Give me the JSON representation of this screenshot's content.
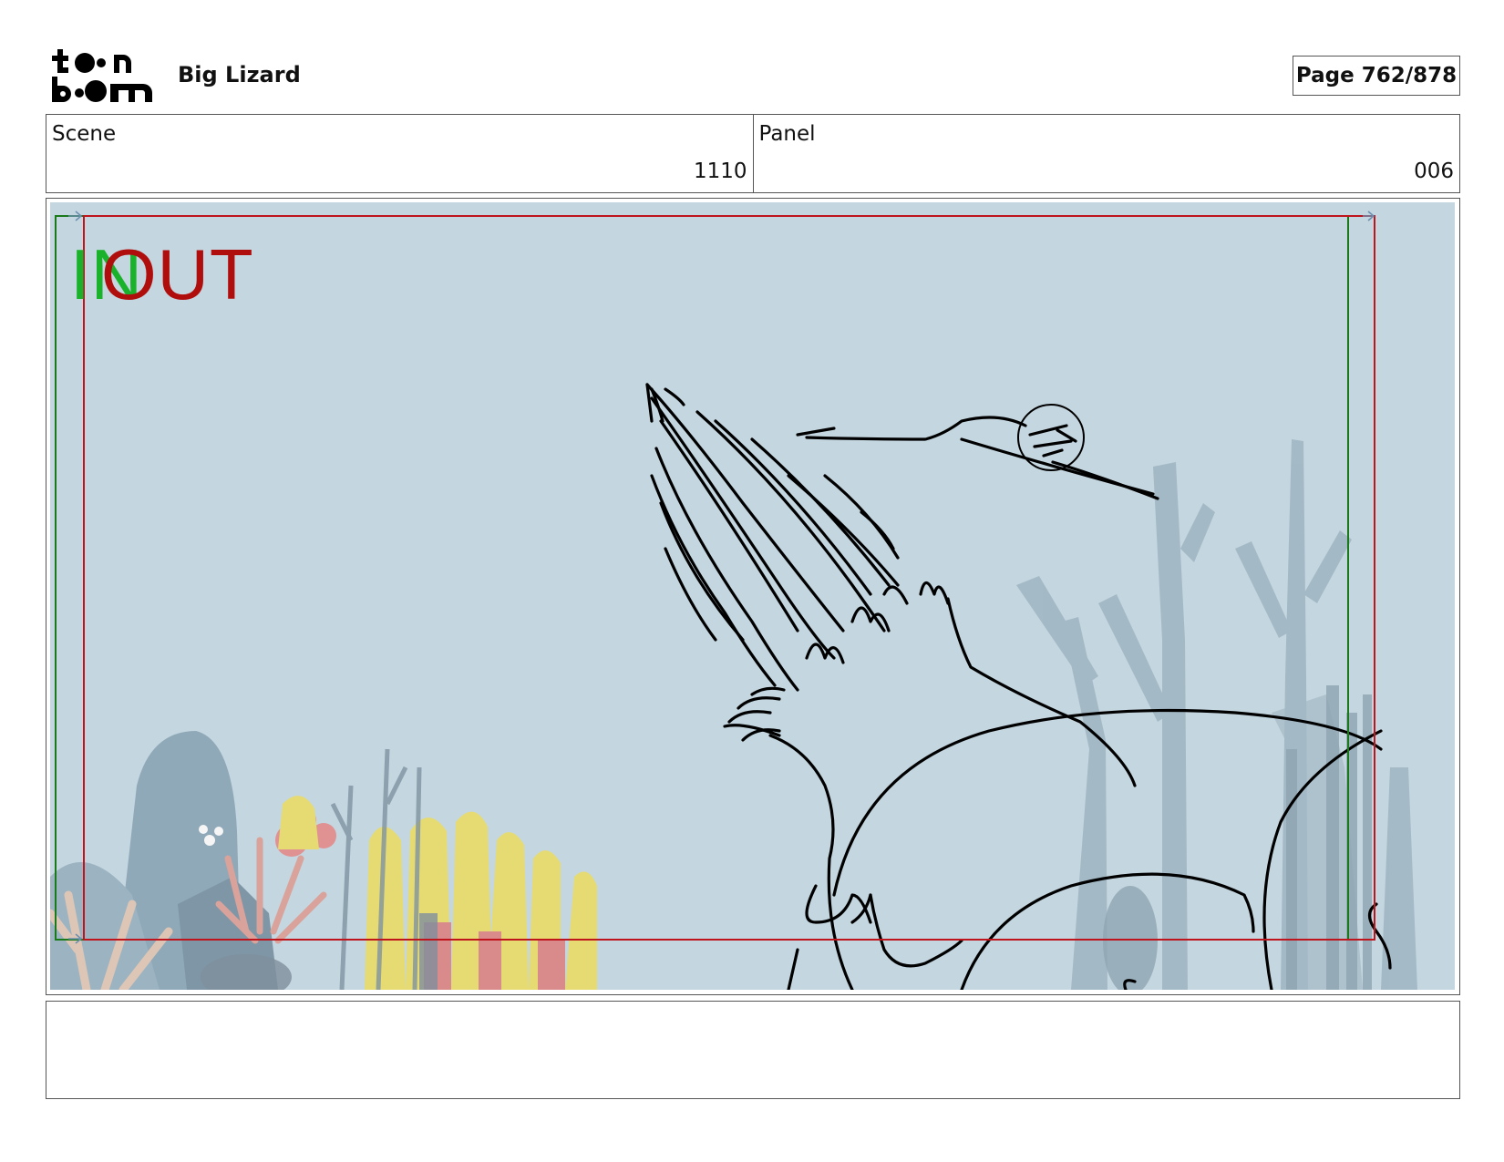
{
  "header": {
    "logo_text": "toon boom",
    "project_title": "Big Lizard",
    "page_counter": "Page 762/878"
  },
  "info": {
    "scene_label": "Scene",
    "scene_value": "1110",
    "panel_label": "Panel",
    "panel_value": "006"
  },
  "panel": {
    "in_marker": "IN",
    "out_marker": "OUT",
    "colors": {
      "background_water": "#c4d6df",
      "in_frame": "#1a7a1a",
      "out_frame": "#c0141c",
      "sketch_line": "#000000"
    }
  },
  "notes": {
    "text": ""
  }
}
